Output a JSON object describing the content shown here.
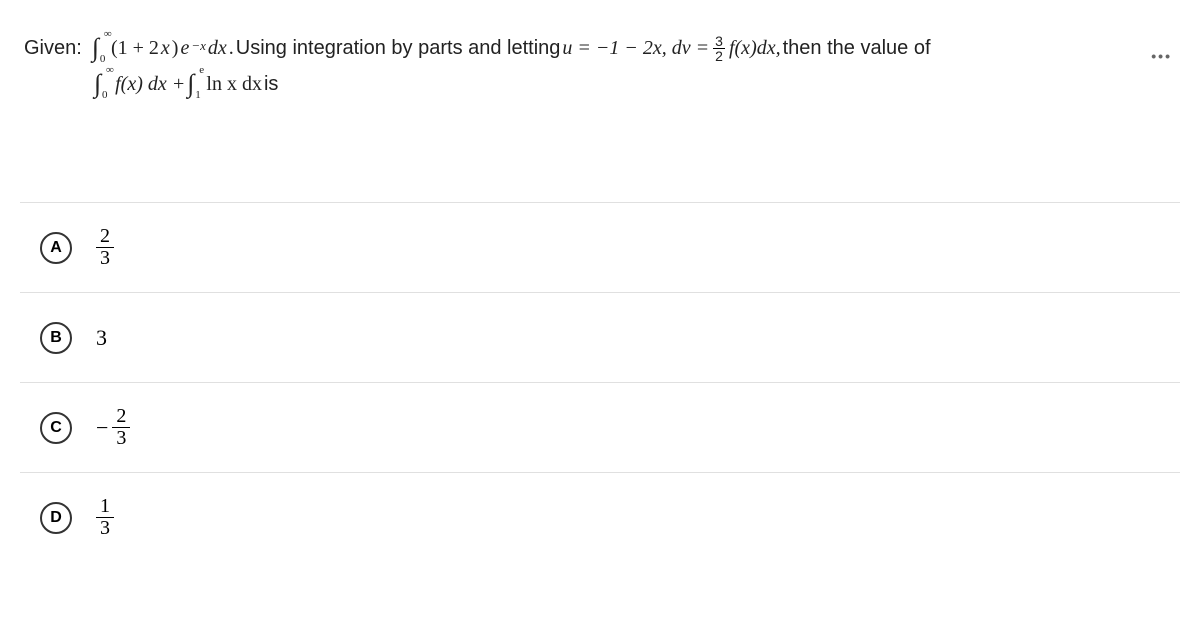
{
  "question": {
    "given_label": "Given:",
    "integral1": {
      "upper": "∞",
      "lower": "0",
      "integrand_open": "(1 + 2",
      "var_x": "x",
      "close_paren": ") ",
      "e": "e",
      "exp": "−x",
      "dx": " dx",
      "period": "."
    },
    "using_text": "  Using integration by parts and letting  ",
    "u_eq": "u = −1 − 2x,  dv = ",
    "frac_num": "3",
    "frac_den": "2",
    "fx_dx": "f(x)dx,",
    "then_text": " then the value of",
    "integral2": {
      "upper": "∞",
      "lower": "0",
      "fx": " f(x) dx + "
    },
    "integral3": {
      "upper": "e",
      "lower": "1",
      "lnx": " ln x dx"
    },
    "is_text": " is"
  },
  "more_dots": "•••",
  "options": {
    "a": {
      "letter": "A",
      "num": "2",
      "den": "3"
    },
    "b": {
      "letter": "B",
      "value": "3"
    },
    "c": {
      "letter": "C",
      "minus": "−",
      "num": "2",
      "den": "3"
    },
    "d": {
      "letter": "D",
      "num": "1",
      "den": "3"
    }
  }
}
